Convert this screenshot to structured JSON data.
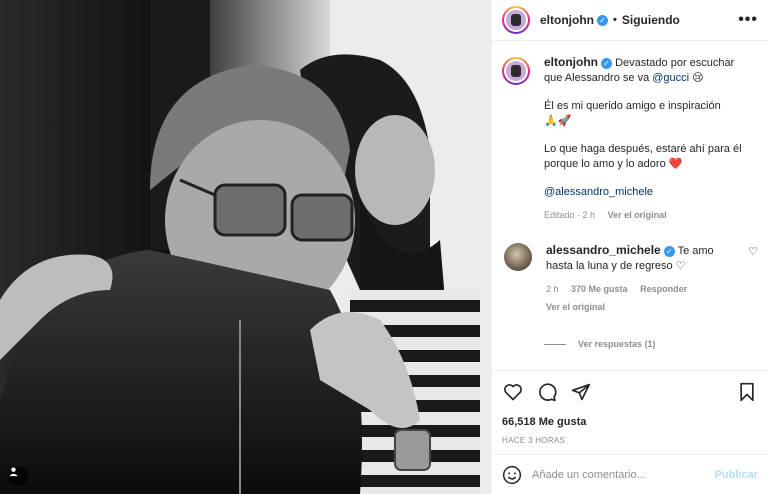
{
  "header": {
    "username": "eltonjohn",
    "verified_glyph": "✓",
    "separator": "•",
    "follow_status": "Siguiendo",
    "more_icon": "more-horizontal-icon",
    "more_glyph": "•••"
  },
  "caption": {
    "username": "eltonjohn",
    "line1": "Devastado por escuchar que Alessandro se va ",
    "mention": "@gucci",
    "emoji1": "😢",
    "para2": "Él es mi querido amigo e inspiración",
    "emoji2": "🙏🚀",
    "para3": "Lo que haga después, estaré ahí para él porque lo amo y lo adoro ",
    "emoji3": "❤️",
    "tag": "@alessandro_michele",
    "edited": "Editado · 2 h",
    "translate": "Ver el original"
  },
  "comment": {
    "username": "alessandro_michele",
    "text": "Te amo hasta la luna y de regreso ",
    "emoji": "♡",
    "time": "2 h",
    "likes": "370 Me gusta",
    "reply": "Responder",
    "translate": "Ver el original",
    "like_glyph": "♡"
  },
  "replies": {
    "label": "Ver respuestas (1)"
  },
  "actions": {
    "icons": [
      "heart-icon",
      "comment-icon",
      "share-icon",
      "bookmark-icon"
    ]
  },
  "likes": {
    "label": "66,518 Me gusta"
  },
  "timestamp": "HACE 3 HORAS",
  "add_comment": {
    "placeholder": "Añade un comentario...",
    "publish": "Publicar"
  },
  "colors": {
    "verified": "#3897f0",
    "link": "#00376b",
    "muted": "#8e8e8e",
    "publish_disabled": "#b2dffc",
    "heart_red": "#ed4956"
  }
}
